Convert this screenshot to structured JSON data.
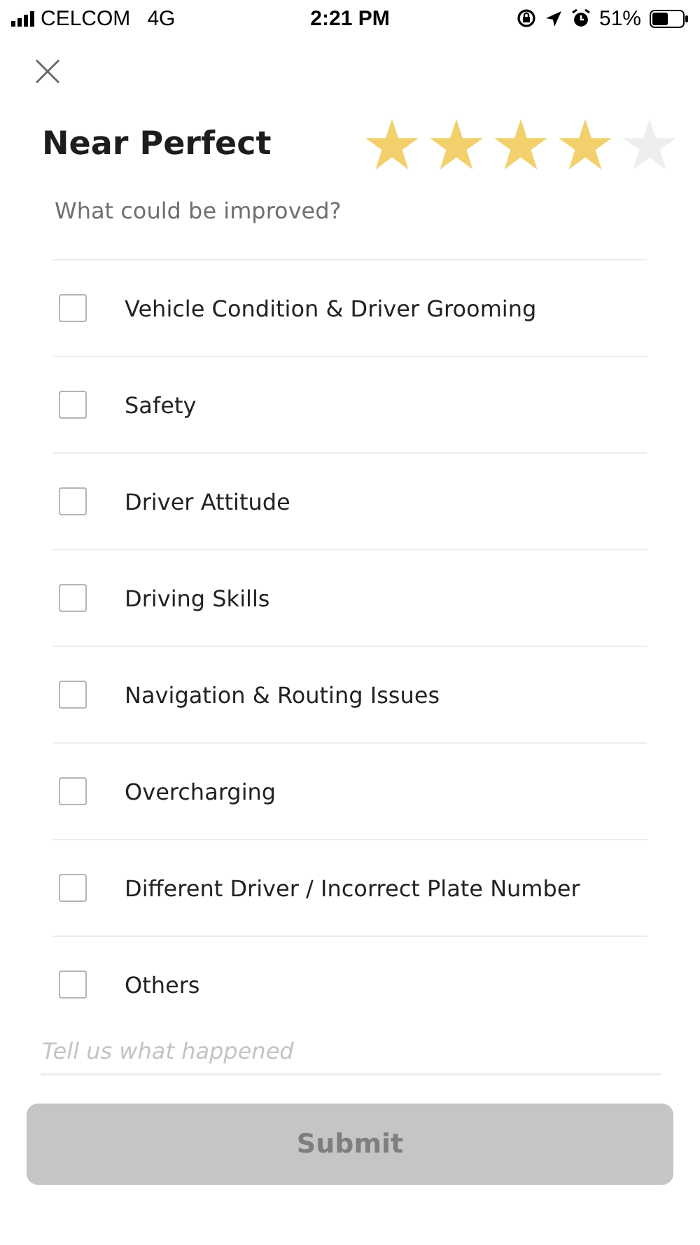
{
  "status_bar": {
    "carrier": "CELCOM",
    "network": "4G",
    "time": "2:21 PM",
    "battery": "51%"
  },
  "rating": {
    "title": "Near Perfect",
    "stars": 4
  },
  "prompt": "What could be improved?",
  "issues": [
    {
      "label": "Vehicle Condition & Driver Grooming",
      "checked": false
    },
    {
      "label": "Safety",
      "checked": false
    },
    {
      "label": "Driver Attitude",
      "checked": false
    },
    {
      "label": "Driving Skills",
      "checked": false
    },
    {
      "label": "Navigation & Routing Issues",
      "checked": false
    },
    {
      "label": "Overcharging",
      "checked": false
    },
    {
      "label": "Different Driver / Incorrect Plate Number",
      "checked": false
    },
    {
      "label": "Others",
      "checked": false
    }
  ],
  "comment": {
    "placeholder": "Tell us what happened"
  },
  "submit": {
    "label": "Submit",
    "disabled": true
  }
}
